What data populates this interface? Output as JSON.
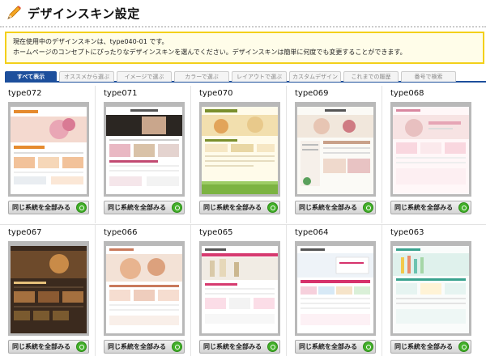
{
  "page": {
    "title": "デザインスキン設定"
  },
  "notice": {
    "line1": "現在使用中のデザインスキンは、type040-01 です。",
    "line2": "ホームページのコンセプトにぴったりなデザインスキンを選んでください。デザインスキンは簡単に何度でも変更することができます。"
  },
  "tabs": [
    {
      "label": "すべて表示"
    },
    {
      "label": "オススメから選ぶ"
    },
    {
      "label": "イメージで選ぶ"
    },
    {
      "label": "カラーで選ぶ"
    },
    {
      "label": "レイアウトで選ぶ"
    },
    {
      "label": "カスタムデザイン"
    },
    {
      "label": "これまでの履歴"
    },
    {
      "label": "番号で検索"
    }
  ],
  "skins": [
    {
      "name": "type072",
      "button": "同じ系統を全部みる"
    },
    {
      "name": "type071",
      "button": "同じ系統を全部みる"
    },
    {
      "name": "type070",
      "button": "同じ系統を全部みる"
    },
    {
      "name": "type069",
      "button": "同じ系統を全部みる"
    },
    {
      "name": "type068",
      "button": "同じ系統を全部みる"
    },
    {
      "name": "type067",
      "button": "同じ系統を全部みる"
    },
    {
      "name": "type066",
      "button": "同じ系統を全部みる"
    },
    {
      "name": "type065",
      "button": "同じ系統を全部みる"
    },
    {
      "name": "type064",
      "button": "同じ系統を全部みる"
    },
    {
      "name": "type063",
      "button": "同じ系統を全部みる"
    }
  ],
  "colors": {
    "accent": "#1d4f9c",
    "notice_border": "#f3d01a",
    "button_icon": "#43b02a"
  }
}
